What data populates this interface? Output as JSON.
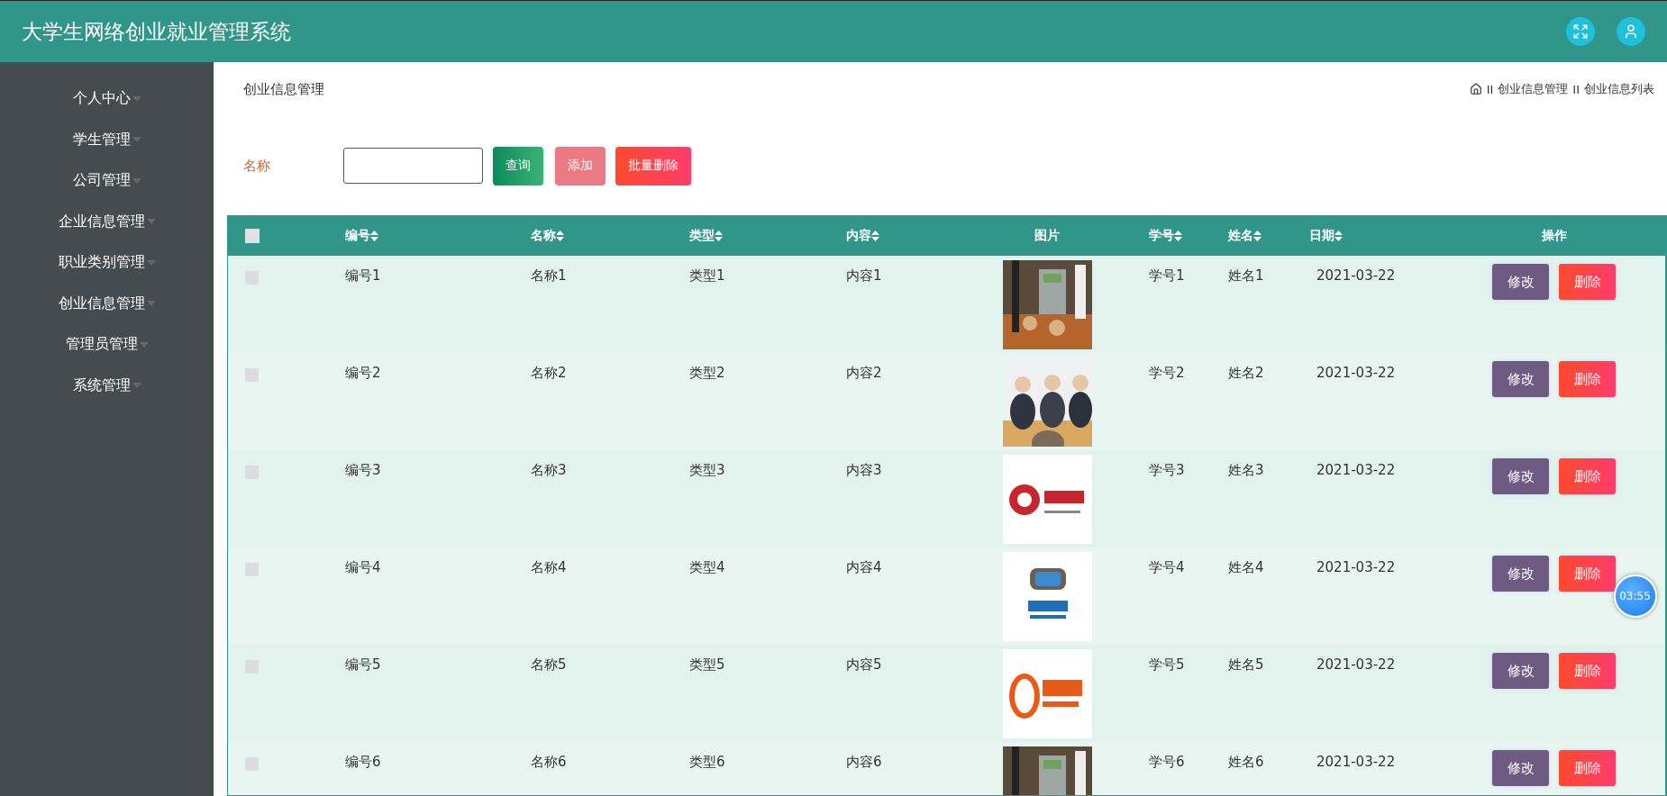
{
  "header": {
    "title": "大学生网络创业就业管理系统"
  },
  "sidebar": {
    "items": [
      {
        "label": "个人中心"
      },
      {
        "label": "学生管理"
      },
      {
        "label": "公司管理"
      },
      {
        "label": "企业信息管理"
      },
      {
        "label": "职业类别管理"
      },
      {
        "label": "创业信息管理"
      },
      {
        "label": "管理员管理"
      },
      {
        "label": "系统管理"
      }
    ]
  },
  "page_title": "创业信息管理",
  "breadcrumb": [
    {
      "separator": "II",
      "label": "创业信息管理"
    },
    {
      "separator": "II",
      "label": "创业信息列表"
    }
  ],
  "search": {
    "label": "名称"
  },
  "buttons": {
    "query": "查询",
    "add": "添加",
    "batch_delete": "批量删除"
  },
  "table": {
    "select_all": {
      "checked": false
    },
    "columns": [
      {
        "label": "编号",
        "sortable": true
      },
      {
        "label": "名称",
        "sortable": true
      },
      {
        "label": "类型",
        "sortable": true
      },
      {
        "label": "内容",
        "sortable": true
      },
      {
        "label": "图片",
        "sortable": false
      },
      {
        "label": "学号",
        "sortable": true
      },
      {
        "label": "姓名",
        "sortable": true
      },
      {
        "label": "日期",
        "sortable": true
      },
      {
        "label": "操作",
        "sortable": false
      }
    ],
    "rows": [
      {
        "checked": false,
        "cells": [
          "编号1",
          "名称1",
          "类型1",
          "内容1",
          "",
          "学号1",
          "姓名1",
          "2021-03-22"
        ],
        "edit": "修改",
        "delete": "删除"
      },
      {
        "checked": false,
        "cells": [
          "编号2",
          "名称2",
          "类型2",
          "内容2",
          "",
          "学号2",
          "姓名2",
          "2021-03-22"
        ],
        "edit": "修改",
        "delete": "删除"
      },
      {
        "checked": false,
        "cells": [
          "编号3",
          "名称3",
          "类型3",
          "内容3",
          "",
          "学号3",
          "姓名3",
          "2021-03-22"
        ],
        "edit": "修改",
        "delete": "删除"
      },
      {
        "checked": false,
        "cells": [
          "编号4",
          "名称4",
          "类型4",
          "内容4",
          "",
          "学号4",
          "姓名4",
          "2021-03-22"
        ],
        "edit": "修改",
        "delete": "删除"
      },
      {
        "checked": false,
        "cells": [
          "编号5",
          "名称5",
          "类型5",
          "内容5",
          "",
          "学号5",
          "姓名5",
          "2021-03-22"
        ],
        "edit": "修改",
        "delete": "删除"
      },
      {
        "checked": false,
        "cells": [
          "编号6",
          "名称6",
          "类型6",
          "内容6",
          "",
          "学号6",
          "姓名6",
          "2021-03-22"
        ],
        "edit": "修改",
        "delete": "删除"
      }
    ]
  },
  "timer_badge": "03:55"
}
